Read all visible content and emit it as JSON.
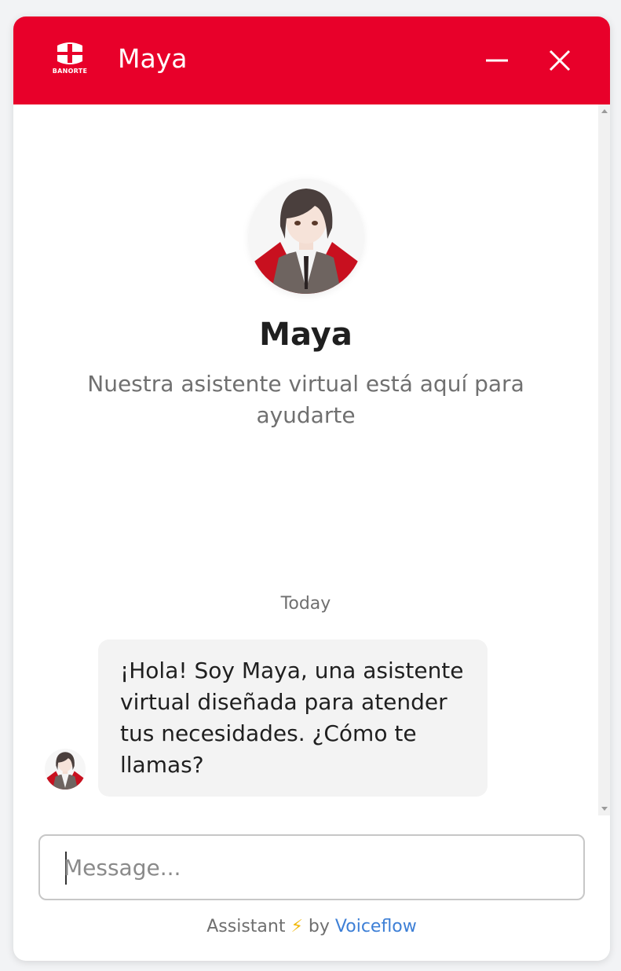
{
  "header": {
    "logo_text": "BANORTE",
    "title": "Maya",
    "icons": {
      "minimize": "minimize-icon",
      "close": "close-icon"
    }
  },
  "intro": {
    "name": "Maya",
    "description": "Nuestra asistente virtual está aquí para ayudarte"
  },
  "chat": {
    "day_label": "Today",
    "messages": [
      {
        "sender": "assistant",
        "text": "¡Hola! Soy Maya, una asistente virtual diseñada para atender tus necesidades. ¿Cómo te llamas?"
      }
    ]
  },
  "composer": {
    "placeholder": "Message...",
    "value": ""
  },
  "footer": {
    "prefix": "Assistant",
    "bolt": "⚡",
    "by": "by",
    "brand": "Voiceflow"
  },
  "colors": {
    "brand_red": "#e8002a",
    "link_blue": "#3d7fd6",
    "bubble_bg": "#f3f3f3"
  }
}
